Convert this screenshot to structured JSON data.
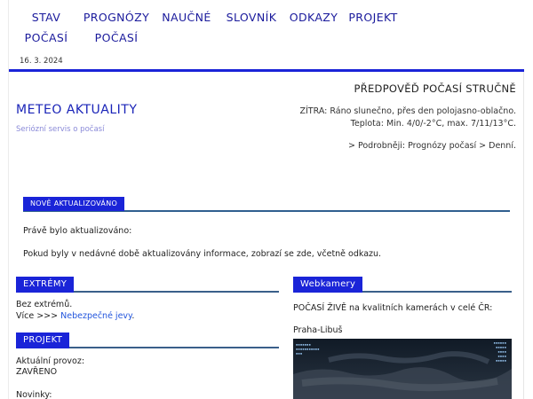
{
  "menu": {
    "items": [
      {
        "id": "stav",
        "line1": "STAV",
        "line2": "POČASÍ"
      },
      {
        "id": "prognozy",
        "line1": "PROGNÓZY",
        "line2": "POČASÍ"
      },
      {
        "id": "naucne",
        "line1": "NAUČNÉ",
        "line2": ""
      },
      {
        "id": "slovnik",
        "line1": "SLOVNÍK",
        "line2": ""
      },
      {
        "id": "odkazy",
        "line1": "ODKAZY",
        "line2": ""
      },
      {
        "id": "projekt",
        "line1": "PROJEKT",
        "line2": ""
      }
    ],
    "date": "16. 3. 2024"
  },
  "brand": {
    "title": "METEO AKTUALITY",
    "subtitle": "Seriózní servis o počasí"
  },
  "forecast": {
    "title": "PŘEDPOVĚĎ POČASÍ STRUČNĚ",
    "tomorrow": "ZÍTRA: Ráno slunečno, přes den polojasno-oblačno.",
    "temperature": "Teplota: Min. 4/0/-2°C, max. 7/11/13°C.",
    "more_link": "> Podrobněji: Prognózy počasí > Denní."
  },
  "updated": {
    "tag": "NOVĚ AKTUALIZOVÁNO",
    "line1": "Právě bylo aktualizováno:",
    "line2": "Pokud byly v nedávné době aktualizovány informace, zobrazí se zde, včetně odkazu."
  },
  "extremes": {
    "tag": "EXTRÉMY",
    "line1": "Bez extrémů.",
    "more_prefix": "Více >>> ",
    "more_link": "Nebezpečné jevy",
    "more_suffix": "."
  },
  "webcams": {
    "tag": "Webkamery",
    "intro": "POČASÍ ŽIVĚ na kvalitních kamerách v celé ČR:",
    "camera_name": "Praha-Libuš"
  },
  "project": {
    "tag": "PROJEKT",
    "provoz_label": "Aktuální provoz:",
    "provoz_value": "ZAVŘENO",
    "news_label": "Novinky:"
  },
  "colors": {
    "accent": "#1a24d8",
    "title_blue": "#1a24b8",
    "section_rule": "#3a5f8a"
  }
}
